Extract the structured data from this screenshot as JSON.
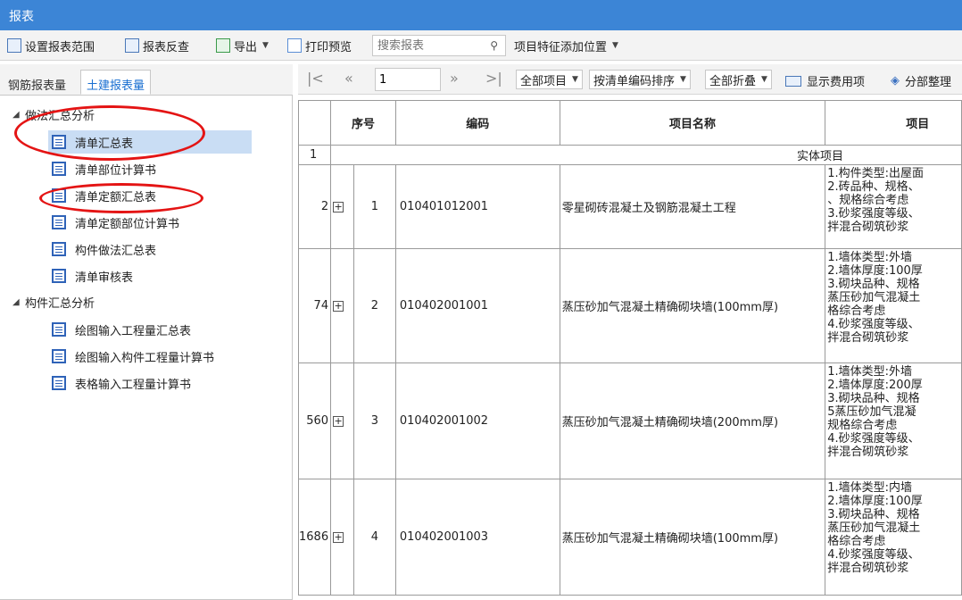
{
  "window": {
    "title": "报表"
  },
  "toolbar": {
    "set_range": "设置报表范围",
    "reverse_check": "报表反查",
    "export": "导出",
    "print_preview": "打印预览",
    "search_placeholder": "搜索报表",
    "feature_position": "项目特征添加位置"
  },
  "tabs": {
    "rebar": "钢筋报表量",
    "civil": "土建报表量"
  },
  "tree": {
    "group1": "做法汇总分析",
    "group1_items": [
      "清单汇总表",
      "清单部位计算书",
      "清单定额汇总表",
      "清单定额部位计算书",
      "构件做法汇总表",
      "清单审核表"
    ],
    "group2": "构件汇总分析",
    "group2_items": [
      "绘图输入工程量汇总表",
      "绘图输入构件工程量计算书",
      "表格输入工程量计算书"
    ]
  },
  "nav": {
    "page": "1",
    "all_items": "全部项目",
    "sort": "按清单编码排序",
    "fold": "全部折叠",
    "show_fee": "显示费用项",
    "section_arrange": "分部整理"
  },
  "table": {
    "headers": {
      "seq": "序号",
      "code": "编码",
      "name": "项目名称",
      "feature": "项目"
    },
    "section_row": {
      "rownum": "1",
      "label": "实体项目"
    },
    "rows": [
      {
        "rownum": "2",
        "seq": "1",
        "code": "010401012001",
        "name": "零星砌砖混凝土及钢筋混凝土工程",
        "feature": [
          "1.构件类型:出屋面",
          "2.砖品种、规格、",
          "、规格综合考虑",
          "3.砂浆强度等级、",
          "拌混合砌筑砂浆"
        ]
      },
      {
        "rownum": "74",
        "seq": "2",
        "code": "010402001001",
        "name": "蒸压砂加气混凝土精确砌块墙(100mm厚)",
        "feature": [
          "1.墙体类型:外墙",
          "2.墙体厚度:100厚",
          "3.砌块品种、规格",
          "蒸压砂加气混凝土",
          "格综合考虑",
          "4.砂浆强度等级、",
          "拌混合砌筑砂浆"
        ]
      },
      {
        "rownum": "560",
        "seq": "3",
        "code": "010402001002",
        "name": "蒸压砂加气混凝土精确砌块墙(200mm厚)",
        "feature": [
          "1.墙体类型:外墙",
          "2.墙体厚度:200厚",
          "3.砌块品种、规格",
          "5蒸压砂加气混凝",
          "规格综合考虑",
          "4.砂浆强度等级、",
          "拌混合砌筑砂浆"
        ]
      },
      {
        "rownum": "1686",
        "seq": "4",
        "code": "010402001003",
        "name": "蒸压砂加气混凝土精确砌块墙(100mm厚)",
        "feature": [
          "1.墙体类型:内墙",
          "2.墙体厚度:100厚",
          "3.砌块品种、规格",
          "蒸压砂加气混凝土",
          "格综合考虑",
          "4.砂浆强度等级、",
          "拌混合砌筑砂浆"
        ]
      }
    ]
  }
}
